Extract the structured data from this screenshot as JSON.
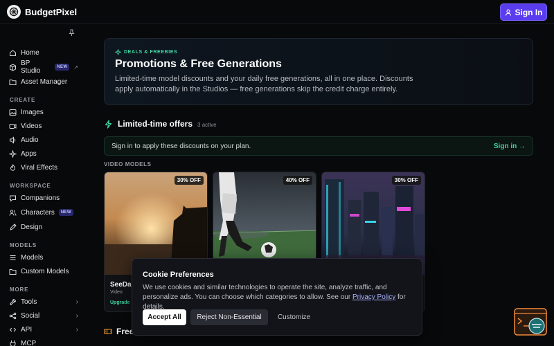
{
  "app": {
    "name": "BudgetPixel"
  },
  "header": {
    "signin_label": "Sign In"
  },
  "sidebar": {
    "top_items": [
      {
        "label": "Home",
        "icon": "home-icon"
      },
      {
        "label": "BP Studio",
        "icon": "box-icon",
        "badge": "NEW"
      },
      {
        "label": "Asset Manager",
        "icon": "folder-icon"
      }
    ],
    "sections": [
      {
        "title": "CREATE",
        "items": [
          {
            "label": "Images",
            "icon": "image-icon"
          },
          {
            "label": "Videos",
            "icon": "video-icon"
          },
          {
            "label": "Audio",
            "icon": "audio-icon"
          },
          {
            "label": "Apps",
            "icon": "sparkle-icon"
          },
          {
            "label": "Viral Effects",
            "icon": "flame-icon"
          }
        ]
      },
      {
        "title": "WORKSPACE",
        "items": [
          {
            "label": "Companions",
            "icon": "chat-icon"
          },
          {
            "label": "Characters",
            "icon": "users-icon",
            "badge": "NEW"
          },
          {
            "label": "Design",
            "icon": "design-icon"
          }
        ]
      },
      {
        "title": "MODELS",
        "items": [
          {
            "label": "Models",
            "icon": "list-icon"
          },
          {
            "label": "Custom Models",
            "icon": "folder-icon"
          }
        ]
      },
      {
        "title": "MORE",
        "items": [
          {
            "label": "Tools",
            "icon": "tools-icon"
          },
          {
            "label": "Social",
            "icon": "share-icon"
          },
          {
            "label": "API",
            "icon": "code-icon"
          },
          {
            "label": "MCP",
            "icon": "plug-icon"
          }
        ]
      }
    ]
  },
  "hero": {
    "tag": "DEALS & FREEBIES",
    "title": "Promotions & Free Generations",
    "description": "Limited-time model discounts and your daily free generations, all in one place. Discounts apply automatically in the Studios — free generations skip the credit charge entirely."
  },
  "offers": {
    "title": "Limited-time offers",
    "count": "3 active",
    "signin_text": "Sign in to apply these discounts on your plan.",
    "signin_link": "Sign in →",
    "section_label": "VIDEO MODELS",
    "cards": [
      {
        "discount": "30% OFF",
        "name": "SeeDar",
        "type": "Video",
        "link": "Upgrade"
      },
      {
        "discount": "40% OFF"
      },
      {
        "discount": "30% OFF"
      }
    ]
  },
  "free": {
    "title": "Free"
  },
  "cookie": {
    "title": "Cookie Preferences",
    "text_before": "We use cookies and similar technologies to operate the site, analyze traffic, and personalize ads. You can choose which categories to allow. See our",
    "link": "Privacy Policy",
    "text_after": "for details.",
    "accept": "Accept All",
    "reject": "Reject Non-Essential",
    "customize": "Customize"
  },
  "colors": {
    "accent": "#5b3df0",
    "green": "#3fd6a2",
    "background": "#08090b"
  }
}
